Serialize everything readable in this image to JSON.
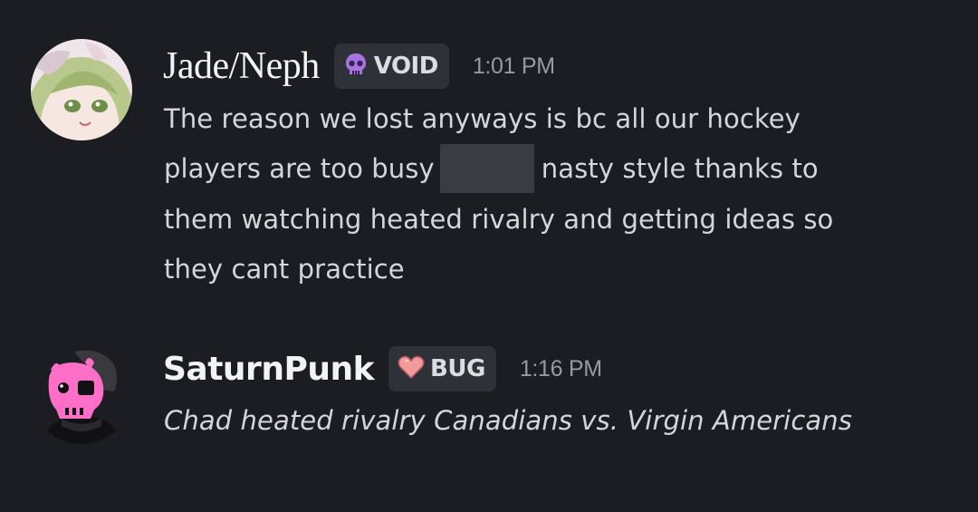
{
  "messages": [
    {
      "username": "Jade/Neph",
      "tag": {
        "label": "VOID",
        "icon": "purple-skull-icon",
        "icon_color": "#a775e0"
      },
      "timestamp": "1:01 PM",
      "lines": [
        "The reason we lost anyways is bc all our hockey",
        {
          "before": "players are too busy",
          "after": "nasty style thanks to"
        },
        "them watching heated rivalry and getting ideas so",
        "they cant practice"
      ]
    },
    {
      "username": "SaturnPunk",
      "tag": {
        "label": "BUG",
        "icon": "pink-heart-icon",
        "icon_color": "#f29a9a"
      },
      "timestamp": "1:16 PM",
      "text": "Chad heated rivalry Canadians vs. Virgin Americans"
    }
  ],
  "colors": {
    "background": "#1c1d22",
    "username": "#f2f3f5",
    "message_text": "#d4d6da",
    "timestamp": "#989aa2",
    "tag_background": "#2f3138",
    "spoiler": "#3a3c43"
  }
}
